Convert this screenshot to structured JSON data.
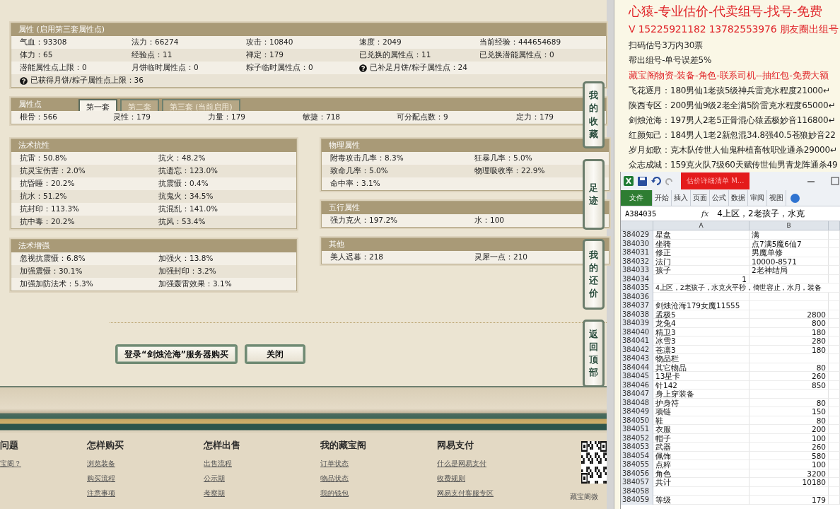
{
  "attributes_panel": {
    "title": "属性 (启用第三套属性点)",
    "rows": [
      [
        {
          "text": "气血：93308",
          "help": false
        },
        {
          "text": "法力：66274",
          "help": false
        },
        {
          "text": "攻击：10840",
          "help": false
        },
        {
          "text": "速度：2049",
          "help": false
        },
        {
          "text": "当前经验：444654689",
          "help": false
        }
      ],
      [
        {
          "text": "体力：65",
          "help": false
        },
        {
          "text": "经验点：11",
          "help": false
        },
        {
          "text": "禅定：179",
          "help": false
        },
        {
          "text": "已兑换的属性点：11",
          "help": false
        },
        {
          "text": "已兑换潜能属性点：0",
          "help": false
        }
      ],
      [
        {
          "text": "潜能属性点上限：0",
          "help": false
        },
        {
          "text": "月饼临时属性点：0",
          "help": false
        },
        {
          "text": "粽子临时属性点：0",
          "help": false
        },
        {
          "text": "已补足月饼/粽子属性点：24",
          "help": true
        }
      ],
      [
        {
          "text": "已获得月饼/粽子属性点上限：36",
          "help": true
        }
      ]
    ]
  },
  "points_panel": {
    "title": "属性点",
    "tabs": [
      {
        "label": "第一套",
        "selected": true
      },
      {
        "label": "第二套",
        "selected": false
      },
      {
        "label": "第三套 (当前启用)",
        "selected": false
      }
    ],
    "values": [
      "根骨：566",
      "灵性：179",
      "力量：179",
      "敏捷：718",
      "可分配点数：9",
      "定力：179"
    ]
  },
  "left_sections": [
    {
      "title": "法术抗性",
      "items": [
        "抗雷：50.8%",
        "抗火：48.2%",
        "抗灵宝伤害：2.0%",
        "抗遗忘：123.0%",
        "抗昏睡：20.2%",
        "抗震慑：0.4%",
        "抗水：51.2%",
        "抗鬼火：34.5%",
        "抗封印：113.3%",
        "抗混乱：141.0%",
        "抗中毒：20.2%",
        "抗风：53.4%"
      ]
    },
    {
      "title": "法术增强",
      "items": [
        "忽视抗震慑：6.8%",
        "加强火：13.8%",
        "加强震慑：30.1%",
        "加强封印：3.2%",
        "加强加防法术：5.3%",
        "加强轰雷效果：3.1%"
      ]
    }
  ],
  "right_sections": [
    {
      "title": "物理属性",
      "items": [
        "附毒攻击几率：8.3%",
        "狂暴几率：5.0%",
        "致命几率：5.0%",
        "物理吸收率：22.9%",
        "命中率：3.1%"
      ]
    },
    {
      "title": "五行属性",
      "items": [
        "强力克火：197.2%",
        "水：100"
      ]
    },
    {
      "title": "其他",
      "items": [
        "美人迟暮：218",
        "灵犀一点：210"
      ]
    }
  ],
  "buttons": [
    "登录“剑烛沧海”服务器购买",
    "关闭"
  ],
  "side_buttons": [
    "我的收藏",
    "足迹",
    "我的还价",
    "返回顶部"
  ],
  "footer": {
    "columns": [
      {
        "heading": "问题",
        "links": [
          "宝阁？"
        ]
      },
      {
        "heading": "怎样购买",
        "links": [
          "浏览装备",
          "购买流程",
          "注意事项"
        ]
      },
      {
        "heading": "怎样出售",
        "links": [
          "出售流程",
          "公示期",
          "考察期"
        ]
      },
      {
        "heading": "我的藏宝阁",
        "links": [
          "订单状态",
          "物品状态",
          "我的钱包"
        ]
      },
      {
        "heading": "网易支付",
        "links": [
          "什么是网易支付",
          "收费规则",
          "网易支付客服专区"
        ]
      }
    ],
    "qr_caption": "藏宝阁微"
  },
  "document": {
    "lines": [
      {
        "kind": "headline",
        "text": "心猿-专业估价-代卖组号-找号-免费"
      },
      {
        "kind": "contact",
        "text": "V 15225921182   13782553976 朋友圈出组号"
      },
      {
        "kind": "body",
        "text": "扫码估号3万内30票"
      },
      {
        "kind": "body",
        "text": "帮出组号-单号误差5%"
      },
      {
        "kind": "ad",
        "text": "藏宝阁物资-装备-角色-联系司机--抽红包-免费大额"
      },
      {
        "kind": "body",
        "text": "飞花逐月：180男仙1老孩5级神兵雷克水程度21000↵"
      },
      {
        "kind": "body",
        "text": "陕西专区：200男仙9级2老全满5阶雷克水程度65000↵"
      },
      {
        "kind": "body",
        "text": "剑烛沧海：197男人2老5正骨混心猿孟极妙音116800↵"
      },
      {
        "kind": "body",
        "text": "红颜知己：184男人1老2新忽混34.8强40.5苍狼妙音22"
      },
      {
        "kind": "body",
        "text": "岁月如歌：克木队传世人仙鬼种植畜牧职业通杀29000↵"
      },
      {
        "kind": "body",
        "text": "众志成城：159克火队7级60天赋传世仙男青龙阵通杀49"
      }
    ]
  },
  "spreadsheet": {
    "title": "估价详细清单 M...",
    "ribbon_tabs": [
      {
        "label": "文件",
        "selected": true
      },
      {
        "label": "开始",
        "selected": false
      },
      {
        "label": "插入",
        "selected": false
      },
      {
        "label": "页面",
        "selected": false
      },
      {
        "label": "公式",
        "selected": false
      },
      {
        "label": "数据",
        "selected": false
      },
      {
        "label": "审阅",
        "selected": false
      },
      {
        "label": "视图",
        "selected": false
      }
    ],
    "name_box": "A384035",
    "fx": "fx",
    "formula": "4上区，2老孩子，水克",
    "columns": [
      "A",
      "B"
    ],
    "rows": [
      {
        "row": "384029",
        "a": {
          "text": "星盘",
          "kind": "text"
        },
        "b": {
          "text": "满",
          "kind": "text"
        }
      },
      {
        "row": "384030",
        "a": {
          "text": "坐骑",
          "kind": "text"
        },
        "b": {
          "text": "点7满5魔6仙7",
          "kind": "text"
        }
      },
      {
        "row": "384031",
        "a": {
          "text": "修正",
          "kind": "text"
        },
        "b": {
          "text": "男魔单修",
          "kind": "text"
        }
      },
      {
        "row": "384032",
        "a": {
          "text": "法门",
          "kind": "text"
        },
        "b": {
          "text": "10000-8571",
          "kind": "text"
        }
      },
      {
        "row": "384033",
        "a": {
          "text": "孩子",
          "kind": "text"
        },
        "b": {
          "text": "2老神结局",
          "kind": "text"
        }
      },
      {
        "row": "384034",
        "a": {
          "text": "1",
          "kind": "number"
        }
      },
      {
        "row": "384035",
        "a": {
          "text": "4上区，2老孩子，水克火平秒，倚世容止，水月，装备",
          "kind": "spill"
        }
      },
      {
        "row": "384036"
      },
      {
        "row": "384037",
        "a": {
          "text": "剑烛沧海179女魔11555",
          "kind": "text"
        }
      },
      {
        "row": "384038",
        "a": {
          "text": "孟极5",
          "kind": "text"
        },
        "b": {
          "text": "2800",
          "kind": "number"
        }
      },
      {
        "row": "384039",
        "a": {
          "text": "龙兔4",
          "kind": "text"
        },
        "b": {
          "text": "800",
          "kind": "number"
        }
      },
      {
        "row": "384040",
        "a": {
          "text": "精卫3",
          "kind": "text"
        },
        "b": {
          "text": "180",
          "kind": "number"
        }
      },
      {
        "row": "384041",
        "a": {
          "text": "冰雪3",
          "kind": "text"
        },
        "b": {
          "text": "280",
          "kind": "number"
        }
      },
      {
        "row": "384042",
        "a": {
          "text": "苍凛3",
          "kind": "text"
        },
        "b": {
          "text": "180",
          "kind": "number"
        }
      },
      {
        "row": "384043",
        "a": {
          "text": "物品栏",
          "kind": "text"
        }
      },
      {
        "row": "384044",
        "a": {
          "text": "其它物品",
          "kind": "text"
        },
        "b": {
          "text": "80",
          "kind": "number"
        }
      },
      {
        "row": "384045",
        "a": {
          "text": "13星卡",
          "kind": "text"
        },
        "b": {
          "text": "260",
          "kind": "number"
        }
      },
      {
        "row": "384046",
        "a": {
          "text": "针142",
          "kind": "text"
        },
        "b": {
          "text": "850",
          "kind": "number"
        }
      },
      {
        "row": "384047",
        "a": {
          "text": "身上穿装备",
          "kind": "text"
        }
      },
      {
        "row": "384048",
        "a": {
          "text": "护身符",
          "kind": "text"
        },
        "b": {
          "text": "80",
          "kind": "number"
        }
      },
      {
        "row": "384049",
        "a": {
          "text": "项链",
          "kind": "text"
        },
        "b": {
          "text": "150",
          "kind": "number"
        }
      },
      {
        "row": "384050",
        "a": {
          "text": "鞋",
          "kind": "text"
        },
        "b": {
          "text": "80",
          "kind": "number"
        }
      },
      {
        "row": "384051",
        "a": {
          "text": "衣服",
          "kind": "text"
        },
        "b": {
          "text": "200",
          "kind": "number"
        }
      },
      {
        "row": "384052",
        "a": {
          "text": "帽子",
          "kind": "text"
        },
        "b": {
          "text": "100",
          "kind": "number"
        }
      },
      {
        "row": "384053",
        "a": {
          "text": "武器",
          "kind": "text"
        },
        "b": {
          "text": "260",
          "kind": "number"
        }
      },
      {
        "row": "384054",
        "a": {
          "text": "佩饰",
          "kind": "text"
        },
        "b": {
          "text": "580",
          "kind": "number"
        }
      },
      {
        "row": "384055",
        "a": {
          "text": "点粹",
          "kind": "text"
        },
        "b": {
          "text": "100",
          "kind": "number"
        }
      },
      {
        "row": "384056",
        "a": {
          "text": "角色",
          "kind": "text"
        },
        "b": {
          "text": "3200",
          "kind": "number"
        }
      },
      {
        "row": "384057",
        "a": {
          "text": "共计",
          "kind": "text"
        },
        "b": {
          "text": "10180",
          "kind": "number"
        }
      },
      {
        "row": "384058"
      },
      {
        "row": "384059",
        "a": {
          "text": "等级",
          "kind": "text"
        },
        "b": {
          "text": "179",
          "kind": "number"
        }
      }
    ]
  }
}
